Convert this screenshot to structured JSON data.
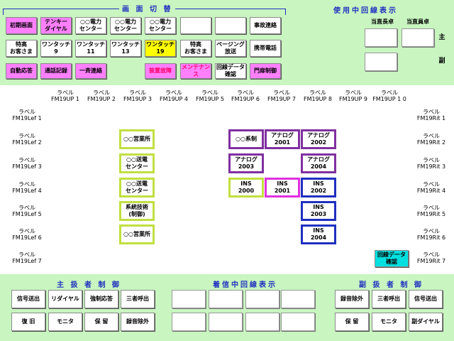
{
  "top": {
    "screen_switch_title": "画 面 切 替",
    "line_in_use_title": "使用中回線表示",
    "duty_chief_label": "当直長卓",
    "duty_member_label": "当直員卓",
    "main_label": "主",
    "sub_label": "副",
    "row1": [
      "初期画面",
      "テンキー\nダイヤル",
      "○○電力\nセンター",
      "○○電力\nセンター",
      "○○電力\nセンター",
      "",
      "",
      "事故連絡"
    ],
    "row2": [
      "特高\nお客さま",
      "ワンタッチ\n9",
      "ワンタッチ\n11",
      "ワンタッチ\n13",
      "ワンタッチ\n19",
      "特高\nお客さま",
      "ページング\n放送",
      "携帯電話"
    ],
    "row3": [
      "自動応答",
      "通話記録",
      "一斉連絡",
      "",
      "装置故障",
      "メンテナン\nス",
      "回線データ\n確認",
      "門扉制御"
    ]
  },
  "middle": {
    "top_labels": [
      "ラベル\nFM19UP 1",
      "ラベル\nFM19UP 2",
      "ラベル\nFM19UP 3",
      "ラベル\nFM19UP 4",
      "ラベル\nFM19UP 5",
      "ラベル\nFM19UP 6",
      "ラベル\nFM19UP 7",
      "ラベル\nFM19UP 8",
      "ラベル\nFM19UP 9",
      "ラベル\nFM19UP 1 0"
    ],
    "left_labels": [
      "ラベル\nFM19Lef 1",
      "ラベル\nFM19Lef 2",
      "ラベル\nFM19Lef 3",
      "ラベル\nFM19Lef 4",
      "ラベル\nFM19Lef 5",
      "ラベル\nFM19Lef 6",
      "ラベル\nFM19Lef 7"
    ],
    "right_labels": [
      "ラベル\nFM19Rit 1",
      "ラベル\nFM19Rit 2",
      "ラベル\nFM19Rit 3",
      "ラベル\nFM19Rit 4",
      "ラベル\nFM19Rit 5",
      "ラベル\nFM19Rit 6",
      "ラベル\nFM19Rit 7"
    ],
    "col3": [
      "○○営業所",
      "○○送電\nセンター",
      "○○送電\nセンター",
      "系統技術\n(制御)",
      "○○営業所"
    ],
    "keitou": "○○系制",
    "analog": [
      "アナログ\n2001",
      "アナログ\n2002",
      "アナログ\n2003",
      "アナログ\n2004"
    ],
    "ins": [
      "INS\n2000",
      "INS\n2001",
      "INS\n2002",
      "INS\n2003",
      "INS\n2004"
    ],
    "line_data_confirm": "回線データ\n確認"
  },
  "bottom": {
    "main_control_title": "主 扱 者 制 御",
    "incoming_title": "着信中回線表示",
    "sub_control_title": "副 扱 者 制 御",
    "main_row1": [
      "信号送出",
      "リダイヤル",
      "強制応答",
      "三者呼出"
    ],
    "main_row2": [
      "復 旧",
      "モニタ",
      "保 留",
      "録音除外"
    ],
    "sub_row1": [
      "録音除外",
      "三者呼出",
      "信号送出"
    ],
    "sub_row2": [
      "保 留",
      "モニタ",
      "副ダイヤル"
    ]
  },
  "colors": {
    "background": "#c8f5c0",
    "pink": "#ff80ff",
    "yellow": "#ffff00",
    "cyan": "#00e0e0",
    "lime": "#c0e040",
    "purple": "#8030a0",
    "blue": "#2030c0",
    "magenta": "#e030e0"
  }
}
